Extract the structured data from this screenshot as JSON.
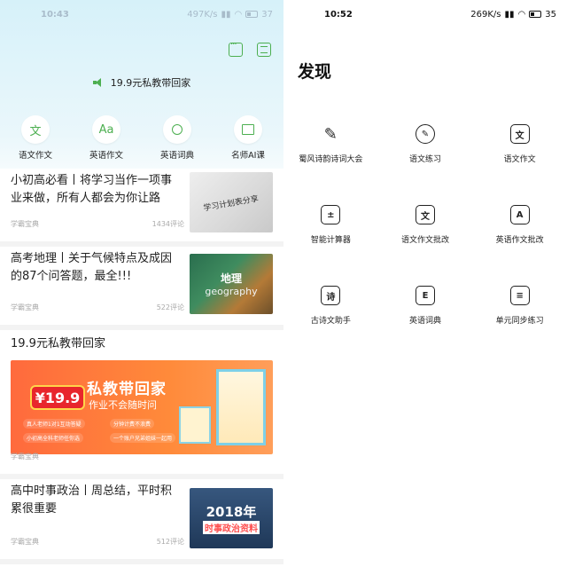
{
  "left": {
    "status": {
      "time": "10:43",
      "speed": "497K/s",
      "battery": "37"
    },
    "notice": "19.9元私教带回家",
    "quick": [
      {
        "label": "语文作文",
        "glyph": "文"
      },
      {
        "label": "英语作文",
        "glyph": "Aa"
      },
      {
        "label": "英语词典",
        "glyph": ""
      },
      {
        "label": "名师AI课",
        "glyph": ""
      }
    ],
    "articles": [
      {
        "title": "小初高必看丨将学习当作一项事业来做，所有人都会为你让路",
        "source": "学霸宝典",
        "count": "1434评论",
        "thumb": "学习计划表分享"
      },
      {
        "title": "高考地理丨关于气候特点及成因的87个问答题，最全!!!",
        "source": "学霸宝典",
        "count": "522评论",
        "thumb": "地理",
        "thumb2": "geography"
      },
      {
        "title": "19.9元私教带回家",
        "source": "学霸宝典",
        "banner": {
          "price": "¥19.9",
          "h1": "私教带回家",
          "h2": "作业不会随时问",
          "tags": [
            "真人老师1对1互动答疑",
            "分钟计费不浪费",
            "小初高全科老师任你选",
            "一个账户兄弟姐妹一起用"
          ]
        }
      },
      {
        "title": "高中时事政治丨周总结，平时积累很重要",
        "source": "学霸宝典",
        "count": "512评论",
        "thumb": "2018年",
        "thumb2": "时事政治资料"
      }
    ]
  },
  "right": {
    "status": {
      "time": "10:52",
      "speed": "269K/s",
      "battery": "35"
    },
    "title": "发现",
    "tools": [
      {
        "label": "蜀风诗韵诗词大会",
        "glyph": "✎"
      },
      {
        "label": "语文练习",
        "glyph": "✎"
      },
      {
        "label": "语文作文",
        "glyph": "文"
      },
      {
        "label": "智能计算器",
        "glyph": "±"
      },
      {
        "label": "语文作文批改",
        "glyph": "文"
      },
      {
        "label": "英语作文批改",
        "glyph": "A"
      },
      {
        "label": "古诗文助手",
        "glyph": "诗"
      },
      {
        "label": "英语词典",
        "glyph": "E"
      },
      {
        "label": "单元同步练习",
        "glyph": "≡"
      }
    ]
  }
}
